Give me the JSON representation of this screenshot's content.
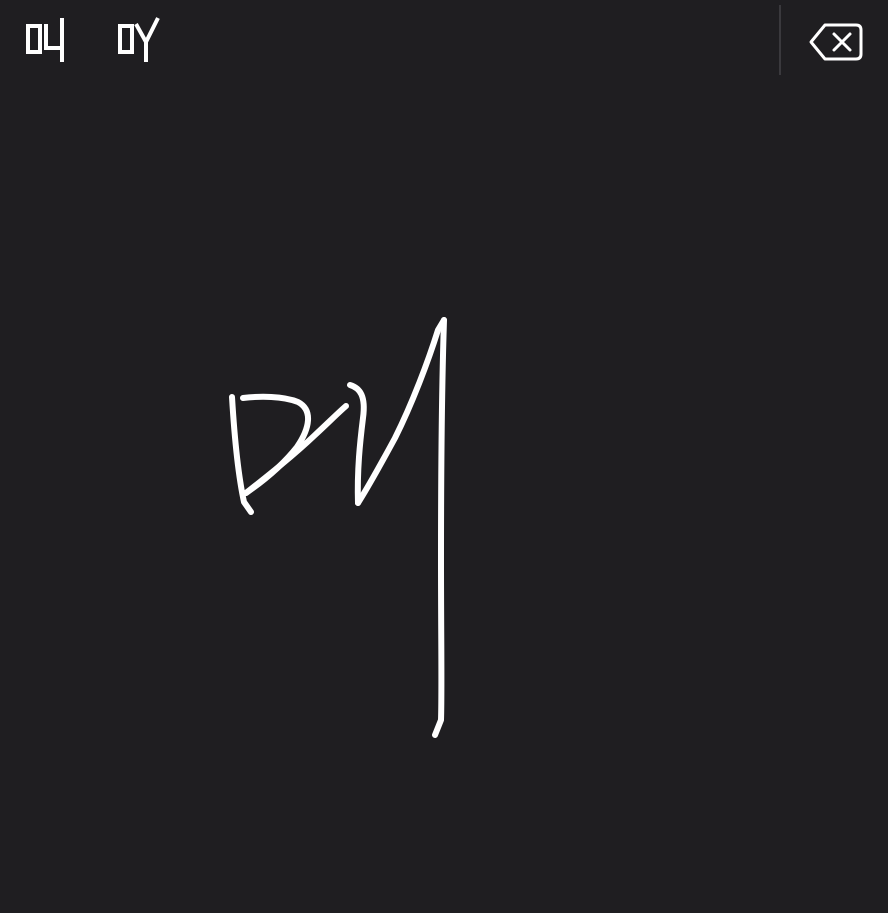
{
  "candidate_bar": {
    "candidates": [
      {
        "label": "머"
      },
      {
        "label": "머"
      }
    ],
    "delete_icon": "backspace-x-icon"
  },
  "colors": {
    "background": "#1f1e21",
    "ink": "#ffffff",
    "divider": "#3a393d"
  }
}
